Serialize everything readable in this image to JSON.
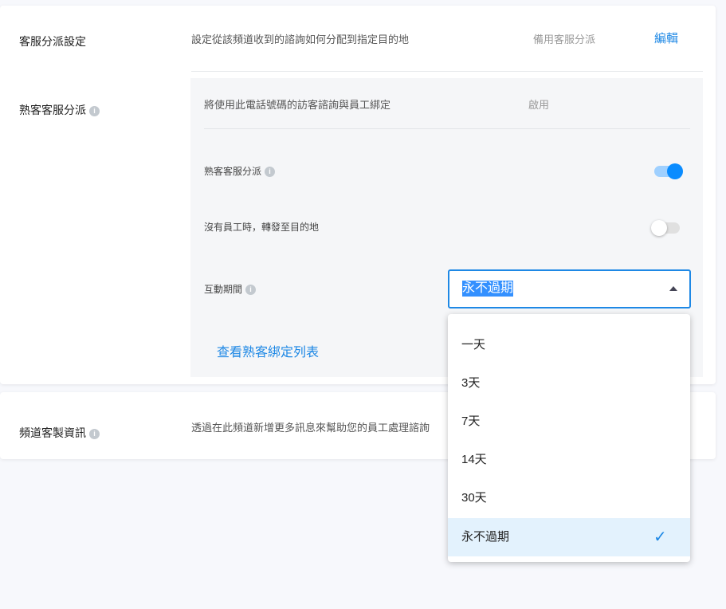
{
  "routing": {
    "label": "客服分派設定",
    "desc": "設定從該頻道收到的諮詢如何分配到指定目的地",
    "value": "備用客服分派",
    "edit": "編輯"
  },
  "sticky": {
    "label": "熟客客服分派",
    "desc": "將使用此電話號碼的訪客諮詢與員工綁定",
    "status": "啟用",
    "toggle1_label": "熟客客服分派",
    "toggle1_on": true,
    "toggle2_label": "沒有員工時，轉發至目的地",
    "toggle2_on": false,
    "period_label": "互動期間",
    "period_value": "永不過期",
    "list_link": "查看熟客綁定列表"
  },
  "custom": {
    "label": "頻道客製資訊",
    "desc": "透過在此頻道新增更多訊息來幫助您的員工處理諮詢"
  },
  "dropdown": {
    "options": [
      "一天",
      "3天",
      "7天",
      "14天",
      "30天",
      "永不過期"
    ],
    "selected": "永不過期"
  },
  "colors": {
    "accent": "#1e88e5",
    "toggle_on": "#0a8cff"
  }
}
